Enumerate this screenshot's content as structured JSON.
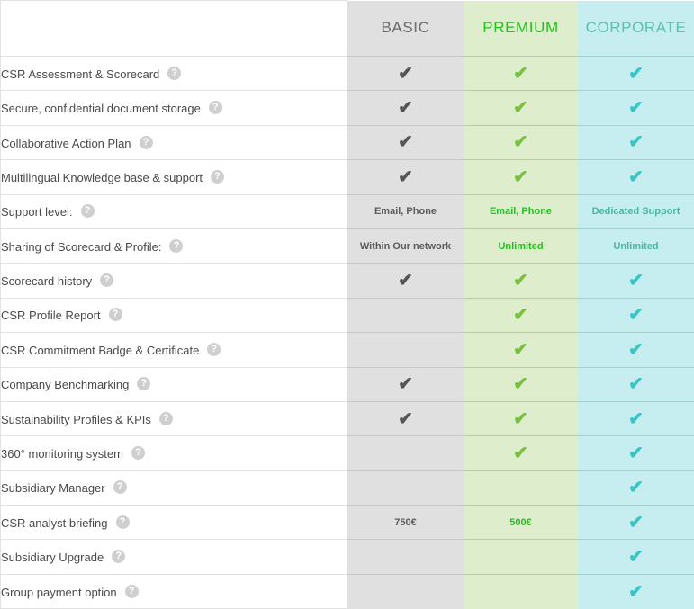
{
  "table": {
    "columns": [
      {
        "key": "feature",
        "label": ""
      },
      {
        "key": "basic",
        "label": "BASIC",
        "color": "#6a6a6a",
        "bg": "#e0e0e0"
      },
      {
        "key": "premium",
        "label": "PREMIUM",
        "color": "#22c11e",
        "bg": "#deedcc"
      },
      {
        "key": "corporate",
        "label": "CORPORATE",
        "color": "#5bbfae",
        "bg": "#c6edf0"
      }
    ],
    "help_icon": "?",
    "check_icon": "check-mark",
    "check_glyph": "✔",
    "rows": [
      {
        "feature": "CSR Assessment & Scorecard",
        "help": "help-icon",
        "basic": "check",
        "premium": "check",
        "corporate": "check"
      },
      {
        "feature": "Secure, confidential document storage",
        "help": "help-icon",
        "basic": "check",
        "premium": "check",
        "corporate": "check"
      },
      {
        "feature": "Collaborative Action Plan",
        "help": "help-icon",
        "basic": "check",
        "premium": "check",
        "corporate": "check"
      },
      {
        "feature": "Multilingual Knowledge base & support",
        "help": "help-icon",
        "basic": "check",
        "premium": "check",
        "corporate": "check"
      },
      {
        "feature": "Support level:",
        "help": "help-icon",
        "basic": "Email, Phone",
        "premium": "Email, Phone",
        "corporate": "Dedicated Support"
      },
      {
        "feature": "Sharing of Scorecard & Profile:",
        "help": "help-icon",
        "basic": "Within Our network",
        "premium": "Unlimited",
        "corporate": "Unlimited"
      },
      {
        "feature": "Scorecard history",
        "help": "help-icon",
        "basic": "check",
        "premium": "check",
        "corporate": "check"
      },
      {
        "feature": "CSR Profile Report",
        "help": "help-icon",
        "basic": "",
        "premium": "check",
        "corporate": "check"
      },
      {
        "feature": "CSR Commitment Badge & Certificate",
        "help": "help-icon",
        "basic": "",
        "premium": "check",
        "corporate": "check"
      },
      {
        "feature": "Company Benchmarking",
        "help": "help-icon",
        "basic": "check",
        "premium": "check",
        "corporate": "check"
      },
      {
        "feature": "Sustainability Profiles & KPIs",
        "help": "help-icon",
        "basic": "check",
        "premium": "check",
        "corporate": "check"
      },
      {
        "feature": "360° monitoring system",
        "help": "help-icon",
        "basic": "",
        "premium": "check",
        "corporate": "check"
      },
      {
        "feature": "Subsidiary Manager",
        "help": "help-icon",
        "basic": "",
        "premium": "",
        "corporate": "check"
      },
      {
        "feature": "CSR analyst briefing",
        "help": "help-icon",
        "basic": "750€",
        "premium": "500€",
        "corporate": "check"
      },
      {
        "feature": "Subsidiary Upgrade",
        "help": "help-icon",
        "basic": "",
        "premium": "",
        "corporate": "check"
      },
      {
        "feature": "Group payment option",
        "help": "help-icon",
        "basic": "",
        "premium": "",
        "corporate": "check"
      }
    ]
  }
}
